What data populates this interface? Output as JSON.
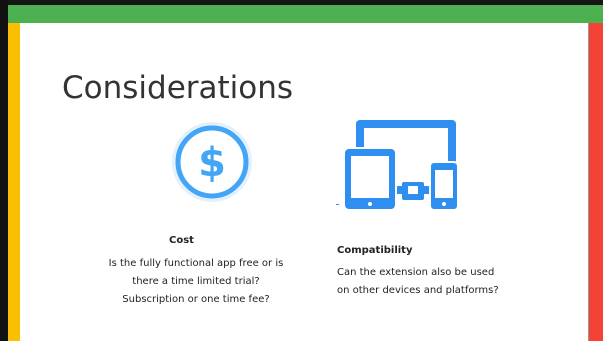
{
  "slide": {
    "title": "Considerations",
    "colors": {
      "top_bar": "#4caf50",
      "left_bar": "#f9bf00",
      "right_bar": "#f44336",
      "dollar_icon": "#42a5f5",
      "devices_icon": "#2f8ff0"
    }
  },
  "cost": {
    "heading": "Cost",
    "icon": "dollar-circle-icon",
    "lines": [
      "Is the fully functional app free or is",
      "there a time limited trial?",
      "Subscription or one time fee?"
    ]
  },
  "compatibility": {
    "heading": "Compatibility",
    "icon": "devices-icon",
    "lines": [
      "Can the extension also be used",
      "on other devices and platforms?"
    ]
  }
}
